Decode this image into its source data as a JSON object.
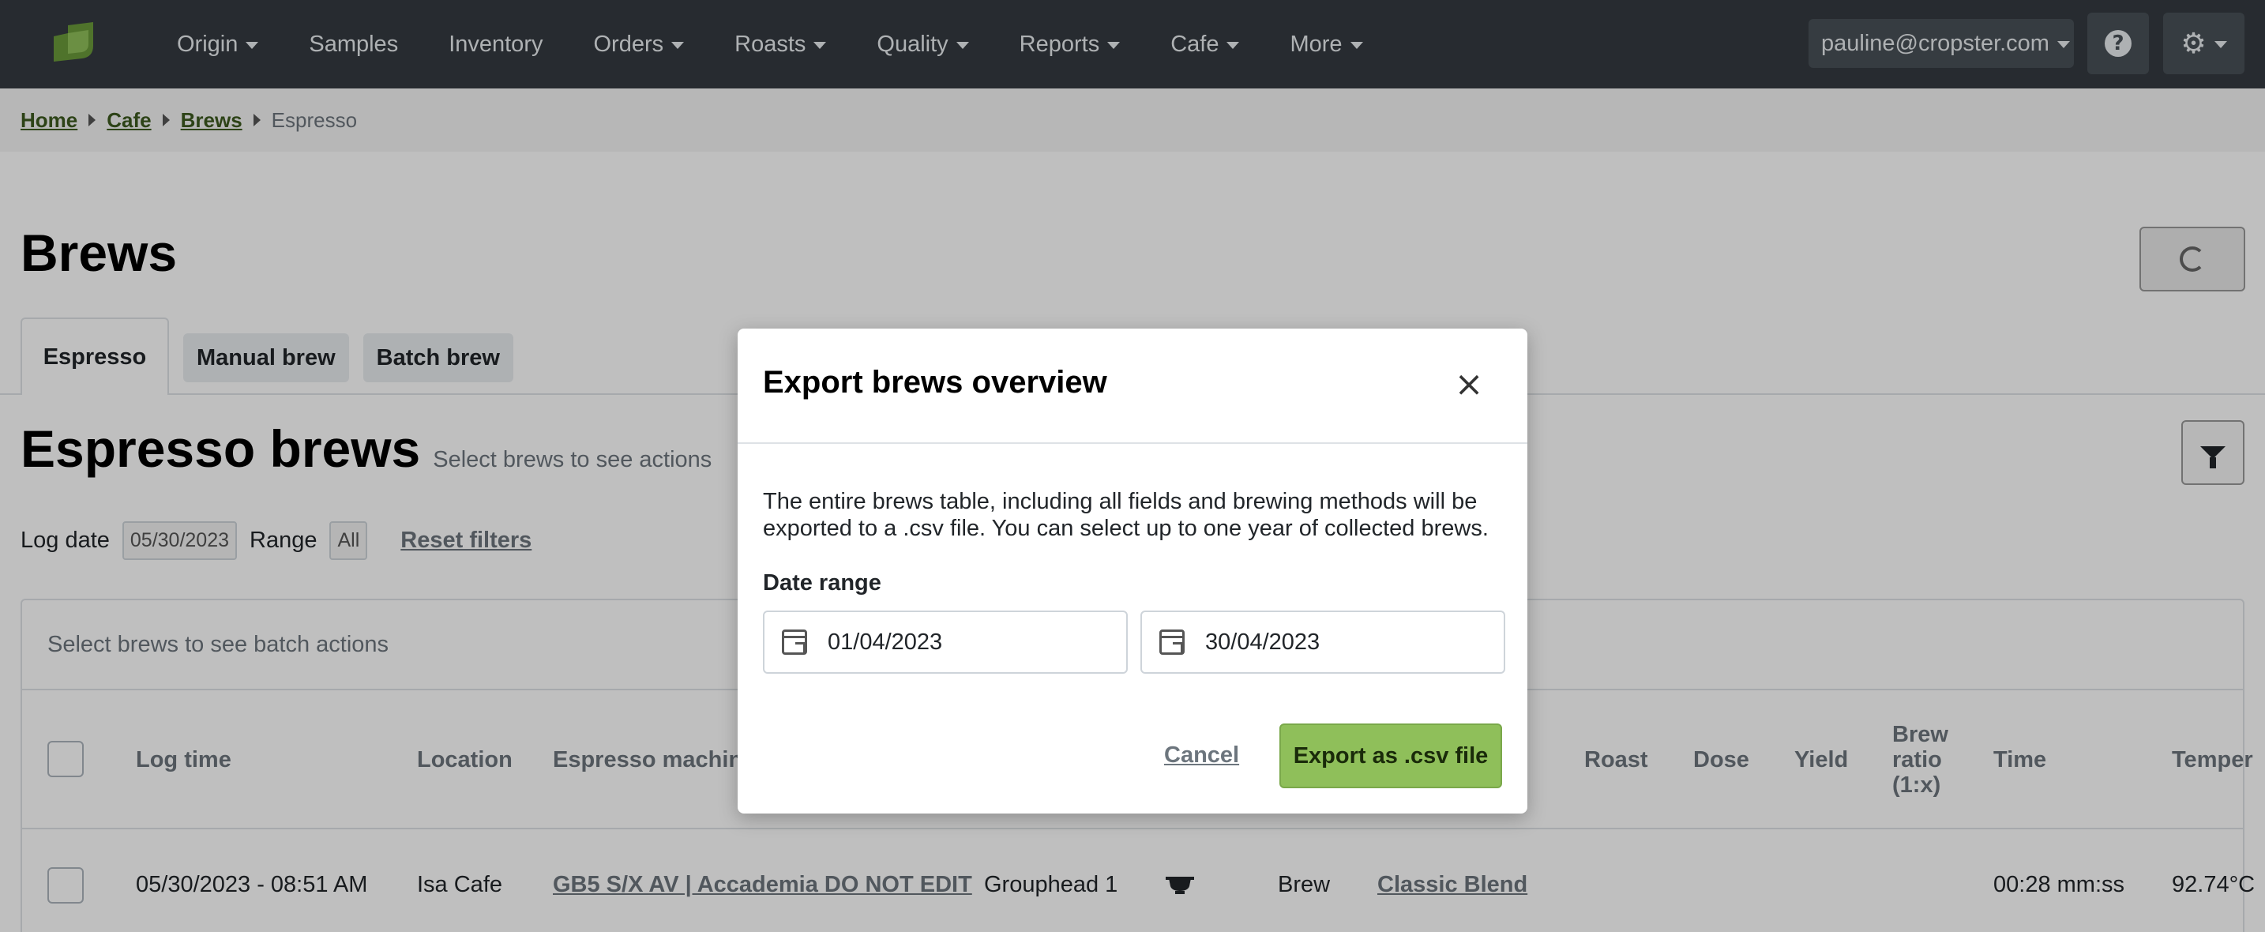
{
  "nav": {
    "items": [
      {
        "label": "Origin",
        "dropdown": true
      },
      {
        "label": "Samples",
        "dropdown": false
      },
      {
        "label": "Inventory",
        "dropdown": false
      },
      {
        "label": "Orders",
        "dropdown": true
      },
      {
        "label": "Roasts",
        "dropdown": true
      },
      {
        "label": "Quality",
        "dropdown": true
      },
      {
        "label": "Reports",
        "dropdown": true
      },
      {
        "label": "Cafe",
        "dropdown": true
      },
      {
        "label": "More",
        "dropdown": true
      }
    ],
    "user": "pauline@cropster.com",
    "help_icon": "question-circle-icon",
    "settings_icon": "gear-icon"
  },
  "breadcrumb": {
    "links": [
      "Home",
      "Cafe",
      "Brews"
    ],
    "current": "Espresso"
  },
  "page": {
    "title": "Brews",
    "tabs": [
      "Espresso",
      "Manual brew",
      "Batch brew"
    ],
    "section_title": "Espresso brews",
    "section_subtitle": "Select brews to see actions"
  },
  "filters": {
    "log_date_label": "Log date",
    "log_date_value": "05/30/2023",
    "range_label": "Range",
    "range_value": "All",
    "reset_label": "Reset filters"
  },
  "table": {
    "batch_actions": "Select brews to see batch actions",
    "columns": {
      "log_time": "Log time",
      "location": "Location",
      "espresso_machine": "Espresso machine",
      "roast": "Roast",
      "dose": "Dose",
      "yield": "Yield",
      "brew_ratio": [
        "Brew",
        "ratio",
        "(1:x)"
      ],
      "time": "Time",
      "temperature": "Temper"
    },
    "rows": [
      {
        "log_time": "05/30/2023 - 08:51 AM",
        "location": "Isa Cafe",
        "machine": "GB5 S/X AV | Accademia DO NOT EDIT",
        "grouphead": "Grouphead 1",
        "type": "Brew",
        "roast": "Classic Blend",
        "time": "00:28 mm:ss",
        "temperature": "92.74°C"
      }
    ]
  },
  "modal": {
    "title": "Export brews overview",
    "description": "The entire brews table, including all fields and brewing methods will be exported to a .csv file. You can select up to one year of collected brews.",
    "date_range_label": "Date range",
    "start_date": "01/04/2023",
    "end_date": "30/04/2023",
    "cancel_label": "Cancel",
    "export_label": "Export as .csv file"
  },
  "colors": {
    "navbar": "#343a40",
    "accent_green": "#8fbf5a",
    "link_green": "#3d5a1f"
  }
}
